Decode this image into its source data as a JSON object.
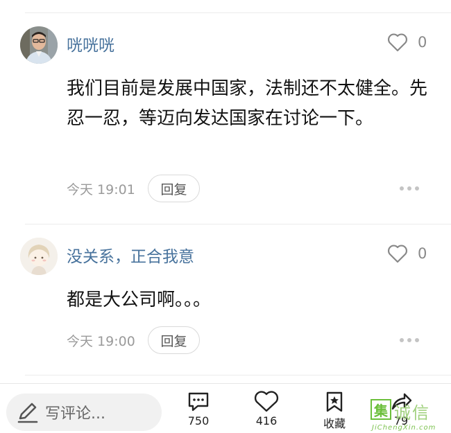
{
  "comments": [
    {
      "username": "咣咣咣",
      "like_count": "0",
      "text": "我们目前是发展中国家，法制还不太健全。先忍一忍，等迈向发达国家在讨论一下。",
      "timestamp": "今天 19:01",
      "reply_label": "回复"
    },
    {
      "username": "没关系，正合我意",
      "like_count": "0",
      "text": "都是大公司啊。。。",
      "timestamp": "今天 19:00",
      "reply_label": "回复"
    }
  ],
  "bottom_bar": {
    "write_placeholder": "写评论...",
    "comment_count": "750",
    "like_count": "416",
    "favorite_label": "收藏",
    "share_count": "79"
  },
  "watermark": {
    "box_char": "集",
    "chinese": "诚信",
    "english": "JiChengXin.com"
  },
  "colors": {
    "username": "#47729c",
    "muted": "#9a9a9a",
    "watermark": "#6bbf3a"
  },
  "icons": [
    "heart-outline-icon",
    "more-dots-icon",
    "pencil-icon",
    "comment-bubble-icon",
    "heart-icon",
    "bookmark-star-icon",
    "share-icon"
  ]
}
